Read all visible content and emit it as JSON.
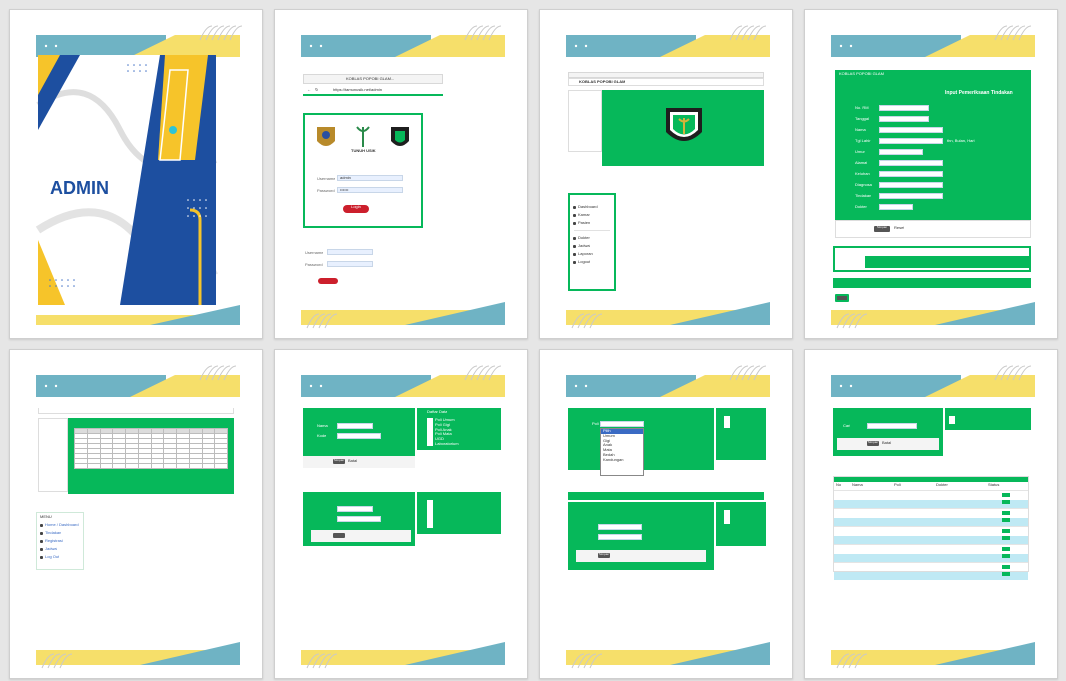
{
  "colors": {
    "green": "#06b85a",
    "blue": "#1d4fa0",
    "teal": "#6fb3c4",
    "yellow": "#f6df6a",
    "red": "#cc1f2c"
  },
  "cover": {
    "title": "ADMIN"
  },
  "login_page": {
    "tab_label": "KOBLAS POPOBI GLAM...",
    "url": "https://tamunusik.net/admin",
    "logo_text": "TUNUH USIK",
    "username_label": "Username",
    "username_value": "admin",
    "password_label": "Password",
    "password_value": "••••••",
    "login_button": "Login"
  },
  "admin_home": {
    "title_bar": "KOBLAS POPOBI GLAM",
    "menu_items": [
      "Dashboard",
      "Kamar",
      "Pasien",
      "Dokter",
      "Jadwal",
      "Laporan",
      "Logout"
    ]
  },
  "input_form": {
    "header": "KOBLAS POPOBI GLAM",
    "title": "Input Pemeriksaan Tindakan",
    "fields": [
      "No. RM",
      "Tanggal",
      "Nama",
      "Tgl Lahir",
      "Umur",
      "Alamat",
      "Keluhan",
      "Diagnosa",
      "Tindakan",
      "Dokter"
    ],
    "umur_suffix": "thn, Bulan, Hari",
    "submit": "Simpan",
    "reset": "Reset"
  },
  "report_page": {
    "sidebar_title": "MENU",
    "sidebar_items": [
      "Home / Dashboard",
      "Tindakan",
      "Registrasi",
      "Jadwal",
      "Log Out"
    ]
  },
  "form_panels": {
    "left_label_1": "Nama",
    "left_label_2": "Kode",
    "right_title": "Daftar Data",
    "save": "Simpan",
    "cancel": "Batal",
    "list_items": [
      "Poli Umum",
      "Poli Gigi",
      "Poli Anak",
      "Poli Mata",
      "UGD",
      "Laboratorium",
      "Radiologi"
    ]
  },
  "dropdown_page": {
    "label": "Poli",
    "options": [
      "Pilih",
      "Umum",
      "Gigi",
      "Anak",
      "Mata",
      "Bedah",
      "Kandungan"
    ],
    "save": "Simpan"
  },
  "table_page": {
    "form_label": "Cari",
    "save": "Simpan",
    "cancel": "Batal",
    "headers": [
      "No",
      "Nama",
      "Poli",
      "Dokter",
      "Status"
    ],
    "rows": 10
  }
}
